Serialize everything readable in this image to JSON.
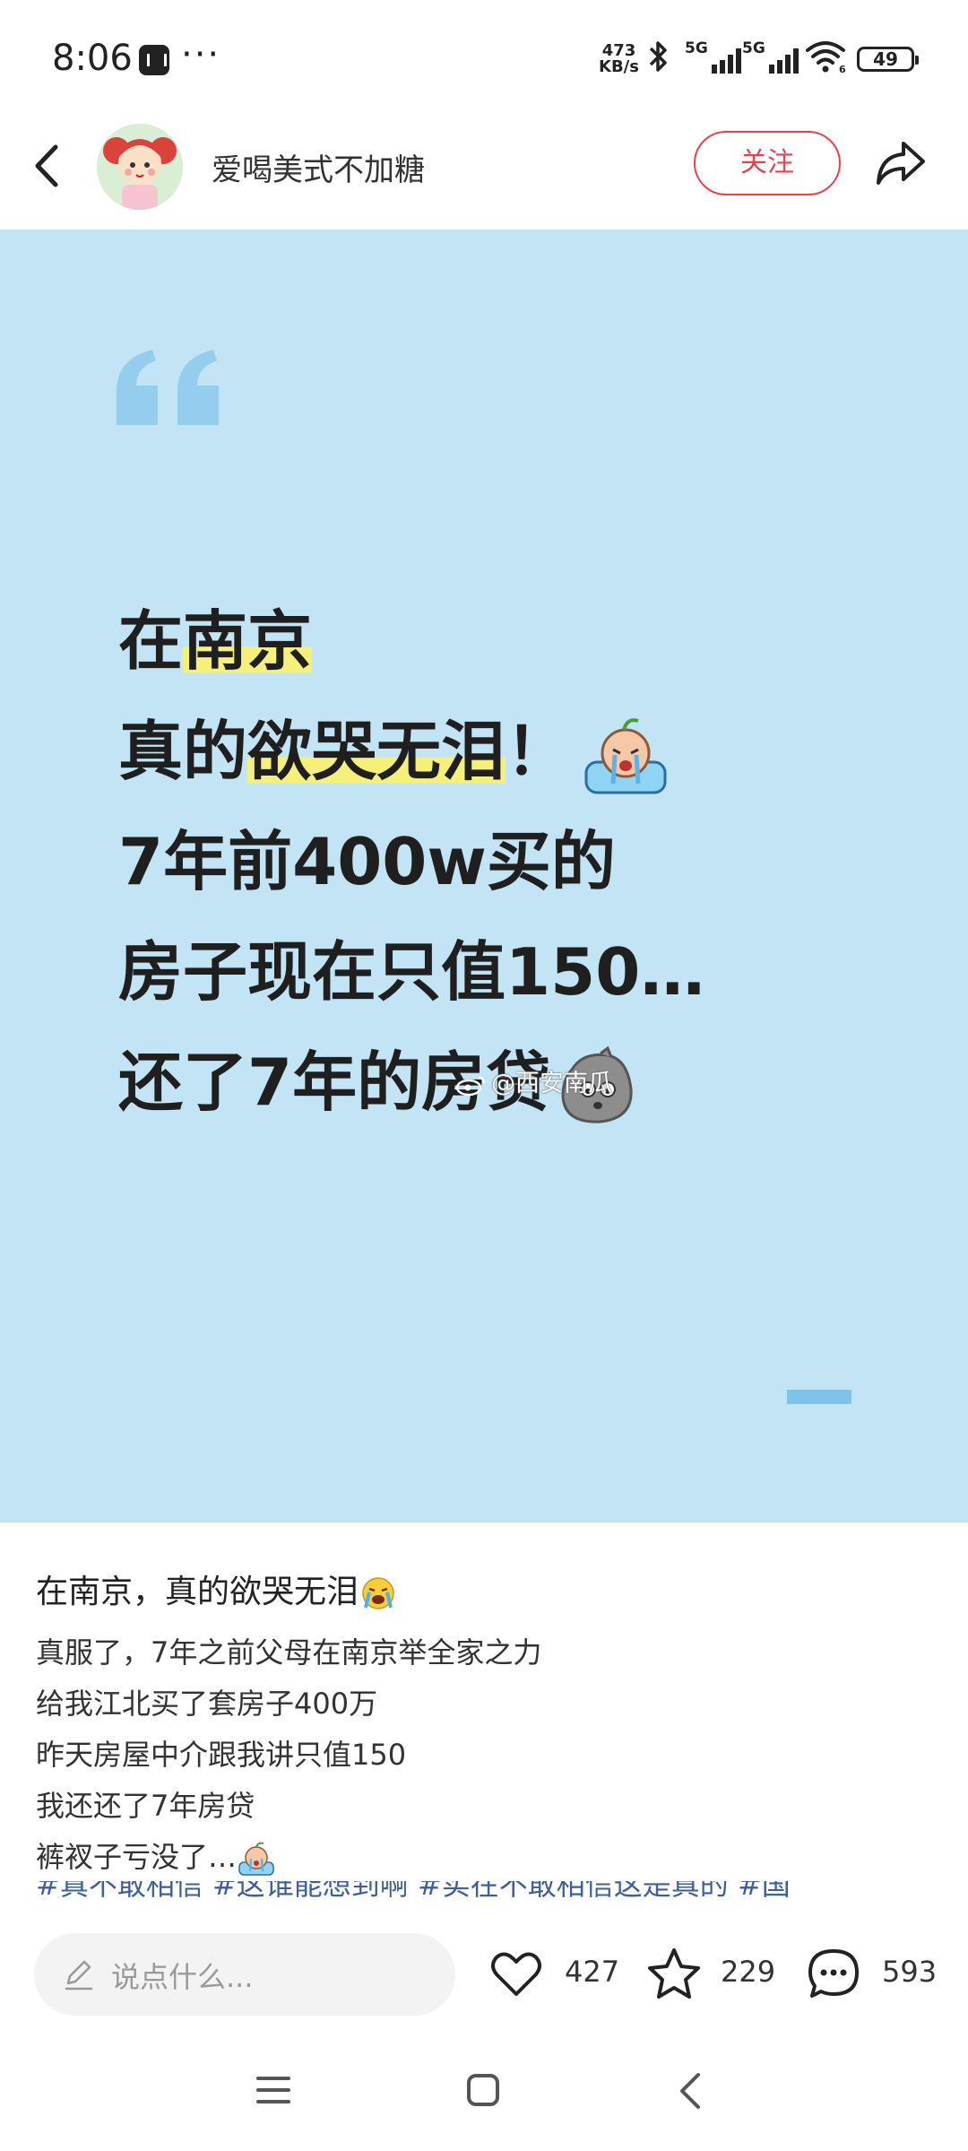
{
  "status_bar": {
    "time": "8:06",
    "more": "···",
    "net_speed_value": "473",
    "net_speed_unit": "KB/s",
    "signal1": "5G",
    "signal2": "5G",
    "battery": "49",
    "wifi_sub": "6"
  },
  "header": {
    "username": "爱喝美式不加糖",
    "follow_label": "关注"
  },
  "cover": {
    "background": "#c2e4f5",
    "lines": [
      "在南京",
      "真的欲哭无泪！",
      "7年前400w买的",
      "房子现在只值150…",
      "还了7年的房贷"
    ],
    "line1_plain": "在",
    "line1_highlight": "南京",
    "line2_plain_a": "真的",
    "line2_highlight": "欲哭无泪",
    "line2_plain_b": "！",
    "watermark": "@西安南瓜"
  },
  "post": {
    "title": "在南京，真的欲哭无泪",
    "body": [
      "真服了，7年之前父母在南京举全家之力",
      "给我江北买了套房子400万",
      "昨天房屋中介跟我讲只值150",
      "我还还了7年房贷",
      "裤衩子亏没了…"
    ],
    "tags": "#真不敢相信 #这谁能想到啊 #实在不敢相信这是真的 #国"
  },
  "action_bar": {
    "comment_placeholder": "说点什么...",
    "likes": "427",
    "favorites": "229",
    "comments": "593"
  },
  "colors": {
    "accent": "#e8424f",
    "highlight": "#f5f07a",
    "tag": "#3d5f9a"
  }
}
